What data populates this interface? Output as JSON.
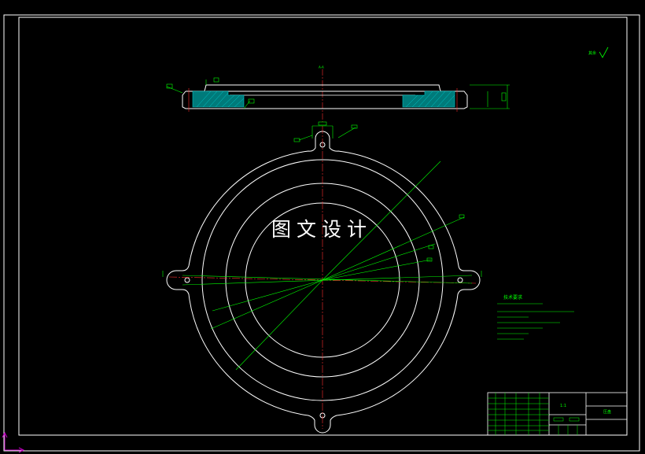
{
  "watermark": {
    "text": "图文设计"
  },
  "drawing": {
    "roughness_note": "其余",
    "centerline_label": "A-A",
    "tech_notes_title": "技术要求",
    "title_block": {
      "part_name": "压盘",
      "drawing_no": "1:1"
    }
  },
  "colors": {
    "background": "#000000",
    "frame": "#ffffff",
    "annotation": "#00ff00",
    "centerline": "#ff0000",
    "hatch": "#00b4b4"
  }
}
